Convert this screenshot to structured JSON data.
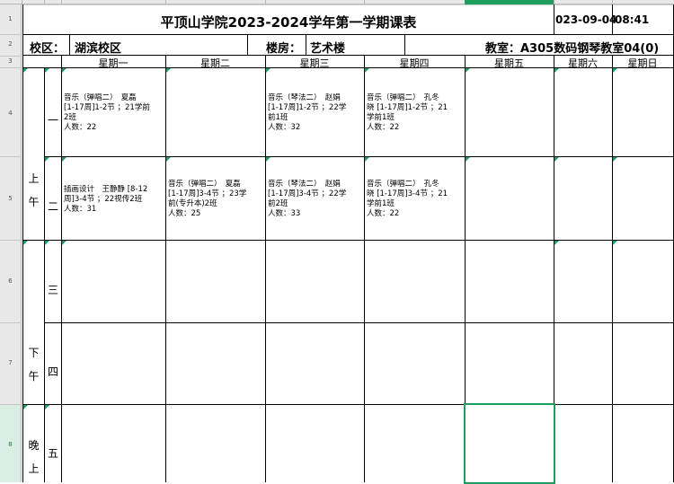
{
  "sheet": {
    "title": "平顶山学院2023-2024学年第一学期课表",
    "date": "023-09-04",
    "time": "08:41",
    "campus_label": "校区：",
    "campus_value": "湖滨校区",
    "building_label": "楼房：",
    "building_value": "艺术楼",
    "classroom_text": "教室：A305数码钢琴教室04(0)",
    "row_numbers": [
      "1",
      "2",
      "3",
      "4",
      "5",
      "6",
      "7",
      "8"
    ],
    "days": [
      "星期一",
      "星期二",
      "星期三",
      "星期四",
      "星期五",
      "星期六",
      "星期日"
    ],
    "periods": [
      {
        "num": "一"
      },
      {
        "num": "二"
      },
      {
        "num": "三"
      },
      {
        "num": "四"
      },
      {
        "num": "五"
      }
    ],
    "segments": {
      "morning_1": "上",
      "morning_2": "午",
      "afternoon_1": "下",
      "afternoon_2": "午",
      "evening_1": "晚",
      "evening_2": "上"
    },
    "courses": {
      "p1_mon": [
        "音乐（弹唱二）　夏磊",
        "[1-17周]1-2节 ；21学前",
        "2班",
        "人数：22"
      ],
      "p1_wed": [
        "音乐（琴法二）　赵娟",
        "[1-17周]1-2节 ；22学",
        "前1班",
        "人数：32"
      ],
      "p1_thu": [
        "音乐（弹唱二）　孔冬",
        "晓 [1-17周]1-2节 ；21",
        "学前1班",
        "人数：22"
      ],
      "p2_mon": [
        "插画设计　王静静 [8-12",
        "周]3-4节 ；22视传2班",
        "人数：31"
      ],
      "p2_tue": [
        "音乐（弹唱二）　夏磊",
        "[1-17周]3-4节 ；23学",
        "前(专升本)2班",
        "人数：25"
      ],
      "p2_wed": [
        "音乐（琴法二）　赵娟",
        "[1-17周]3-4节 ；22学",
        "前2班",
        "人数：33"
      ],
      "p2_thu": [
        "音乐（弹唱二）　孔冬",
        "晓 [1-17周]3-4节 ；21",
        "学前1班",
        "人数：22"
      ]
    }
  }
}
